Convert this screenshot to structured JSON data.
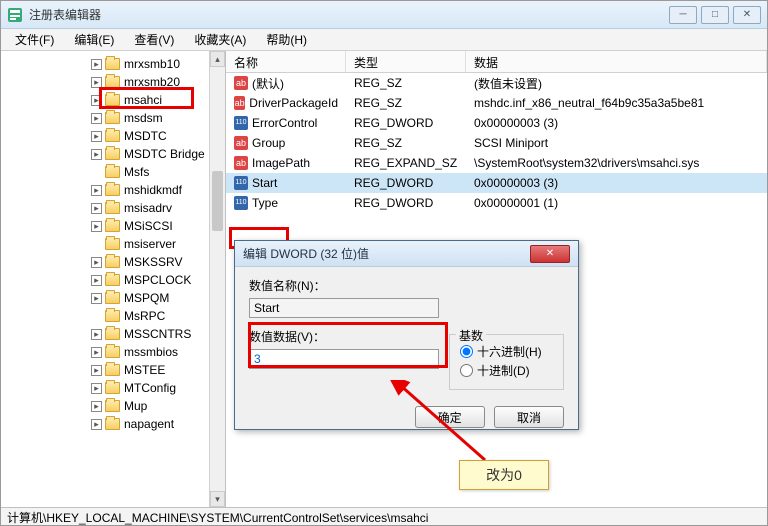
{
  "window": {
    "title": "注册表编辑器"
  },
  "menus": [
    "文件(F)",
    "编辑(E)",
    "查看(V)",
    "收藏夹(A)",
    "帮助(H)"
  ],
  "tree_items": [
    {
      "name": "mrxsmb10",
      "expandable": true
    },
    {
      "name": "mrxsmb20",
      "expandable": true
    },
    {
      "name": "msahci",
      "expandable": true,
      "highlighted": true
    },
    {
      "name": "msdsm",
      "expandable": true
    },
    {
      "name": "MSDTC",
      "expandable": true
    },
    {
      "name": "MSDTC Bridge",
      "expandable": true
    },
    {
      "name": "Msfs",
      "expandable": false
    },
    {
      "name": "mshidkmdf",
      "expandable": true
    },
    {
      "name": "msisadrv",
      "expandable": true
    },
    {
      "name": "MSiSCSI",
      "expandable": true
    },
    {
      "name": "msiserver",
      "expandable": false
    },
    {
      "name": "MSKSSRV",
      "expandable": true
    },
    {
      "name": "MSPCLOCK",
      "expandable": true
    },
    {
      "name": "MSPQM",
      "expandable": true
    },
    {
      "name": "MsRPC",
      "expandable": false
    },
    {
      "name": "MSSCNTRS",
      "expandable": true
    },
    {
      "name": "mssmbios",
      "expandable": true
    },
    {
      "name": "MSTEE",
      "expandable": true
    },
    {
      "name": "MTConfig",
      "expandable": true
    },
    {
      "name": "Mup",
      "expandable": true
    },
    {
      "name": "napagent",
      "expandable": true
    }
  ],
  "list": {
    "headers": {
      "name": "名称",
      "type": "类型",
      "data": "数据"
    },
    "rows": [
      {
        "icon": "sz",
        "name": "(默认)",
        "type": "REG_SZ",
        "data": "(数值未设置)"
      },
      {
        "icon": "sz",
        "name": "DriverPackageId",
        "type": "REG_SZ",
        "data": "mshdc.inf_x86_neutral_f64b9c35a3a5be81"
      },
      {
        "icon": "dw",
        "name": "ErrorControl",
        "type": "REG_DWORD",
        "data": "0x00000003 (3)"
      },
      {
        "icon": "sz",
        "name": "Group",
        "type": "REG_SZ",
        "data": "SCSI Miniport"
      },
      {
        "icon": "sz",
        "name": "ImagePath",
        "type": "REG_EXPAND_SZ",
        "data": "\\SystemRoot\\system32\\drivers\\msahci.sys"
      },
      {
        "icon": "dw",
        "name": "Start",
        "type": "REG_DWORD",
        "data": "0x00000003 (3)",
        "selected": true
      },
      {
        "icon": "dw",
        "name": "Type",
        "type": "REG_DWORD",
        "data": "0x00000001 (1)"
      }
    ]
  },
  "dialog": {
    "title": "编辑 DWORD (32 位)值",
    "name_label": "数值名称(N)：",
    "name_value": "Start",
    "data_label": "数值数据(V)：",
    "data_value": "3",
    "base_label": "基数",
    "radio_hex": "十六进制(H)",
    "radio_dec": "十进制(D)",
    "ok": "确定",
    "cancel": "取消"
  },
  "callout": "改为0",
  "statusbar": "计算机\\HKEY_LOCAL_MACHINE\\SYSTEM\\CurrentControlSet\\services\\msahci"
}
